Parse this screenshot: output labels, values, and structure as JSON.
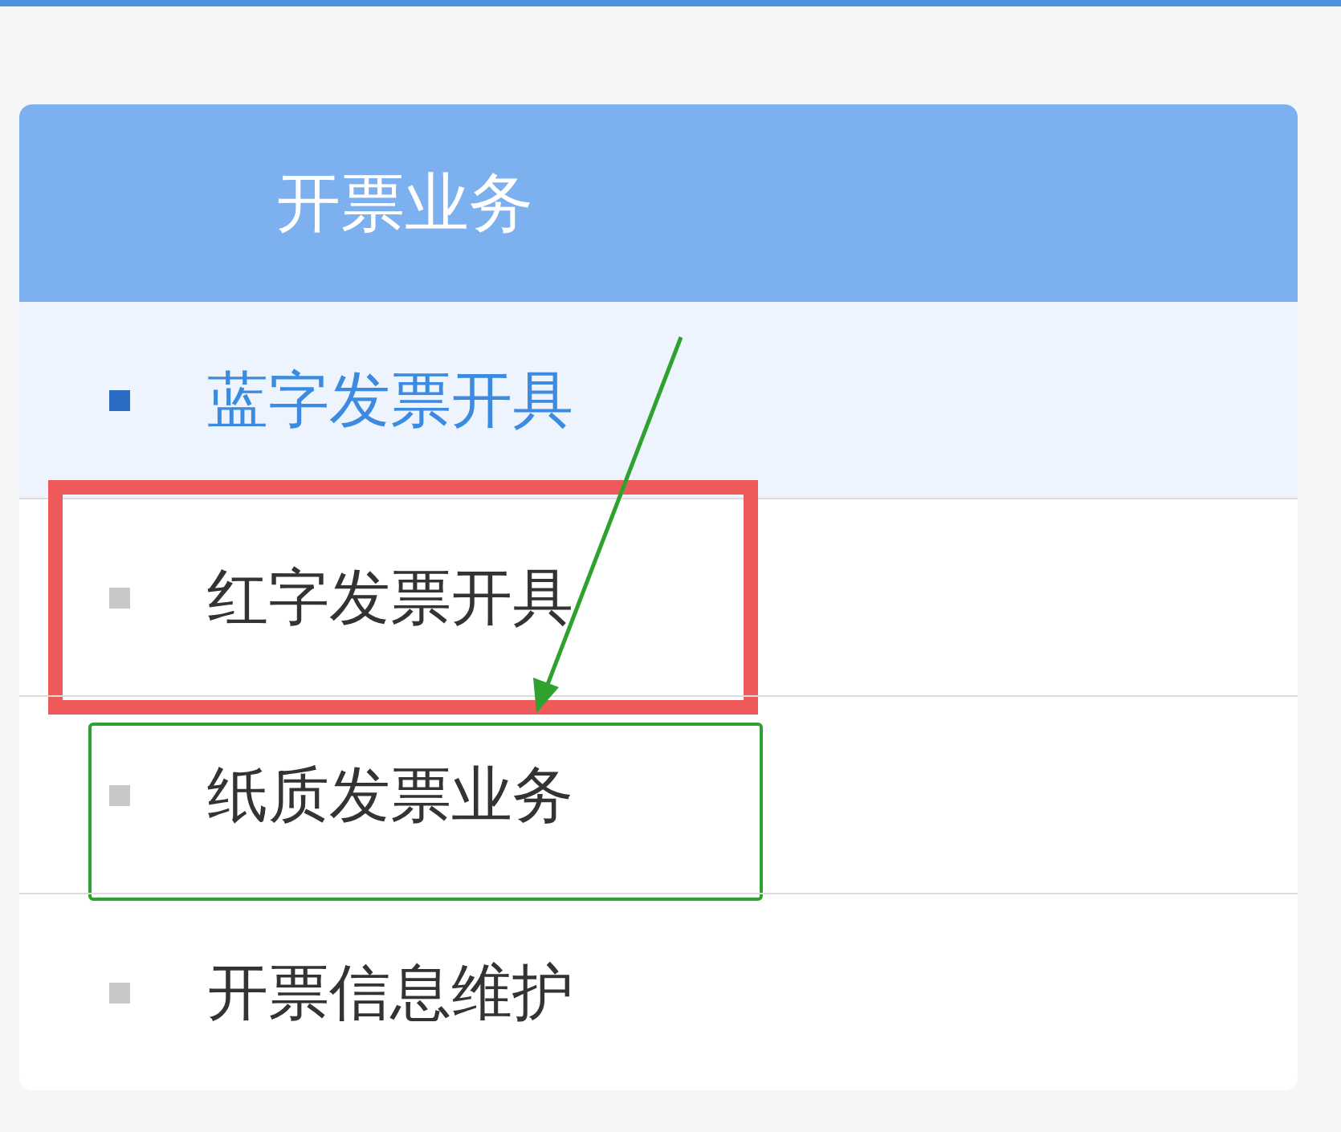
{
  "menu": {
    "title": "开票业务",
    "items": [
      {
        "label": "蓝字发票开具",
        "selected": true
      },
      {
        "label": "红字发票开具",
        "selected": false,
        "outline": {
          "color": "#ee5a5a"
        }
      },
      {
        "label": "纸质发票业务",
        "selected": false,
        "outline": {
          "color": "#2ea12e",
          "arrow": true
        }
      },
      {
        "label": "开票信息维护",
        "selected": false
      }
    ]
  }
}
